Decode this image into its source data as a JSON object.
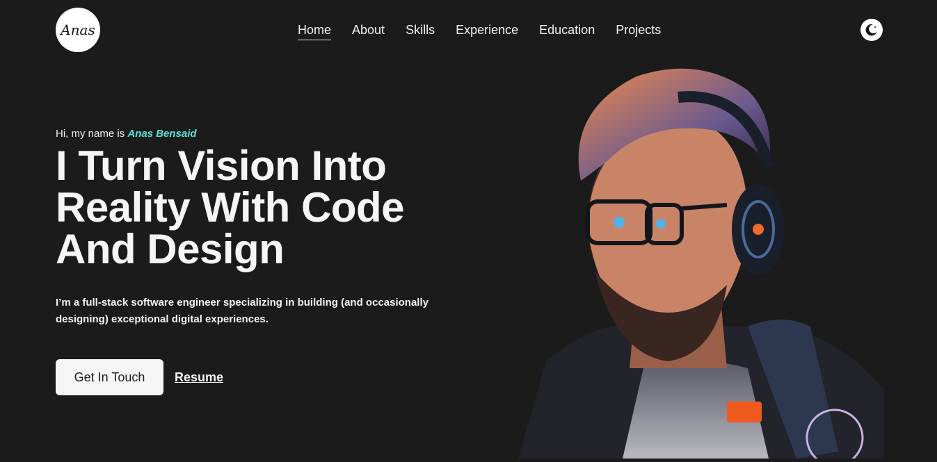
{
  "header": {
    "logo_text": "Anas",
    "nav": [
      {
        "label": "Home",
        "active": true
      },
      {
        "label": "About"
      },
      {
        "label": "Skills"
      },
      {
        "label": "Experience"
      },
      {
        "label": "Education"
      },
      {
        "label": "Projects"
      }
    ],
    "theme_toggle_icon": "moon-icon"
  },
  "hero": {
    "greeting_prefix": "Hi, my name is",
    "name": "Anas Bensaid",
    "headline": "I Turn Vision Into Reality With Code And Design",
    "bio": "I’m a full-stack software engineer specializing in building (and occasionally designing) exceptional digital experiences.",
    "cta_primary": "Get In Touch",
    "cta_secondary": "Resume"
  },
  "image": {
    "subject": "portrait-illustration",
    "icon": "avatar"
  },
  "colors": {
    "background": "#1b1b1b",
    "text": "#f2f2f2",
    "accent": "#5ee0d5",
    "button_bg": "#f5f5f5"
  }
}
